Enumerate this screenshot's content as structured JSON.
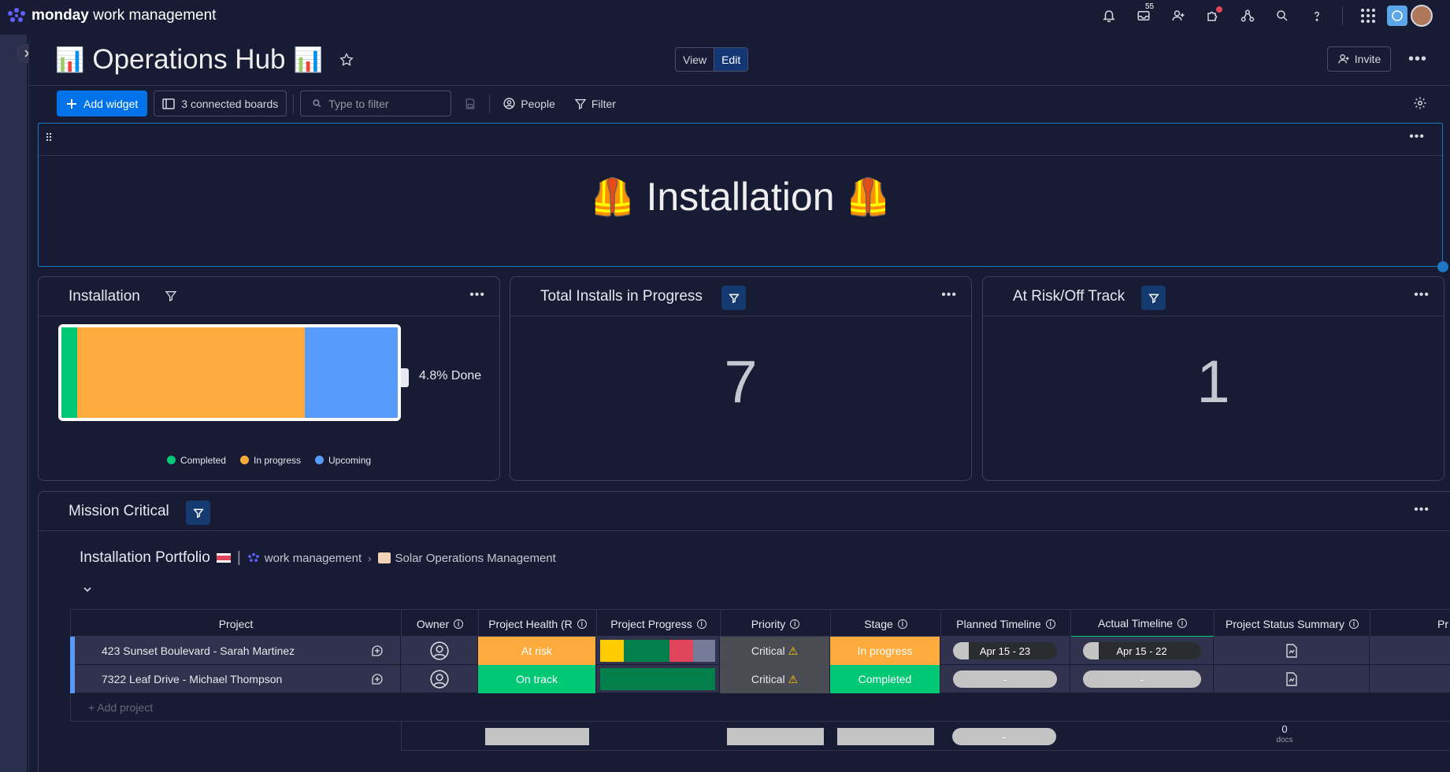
{
  "app": {
    "brand_bold": "monday",
    "brand_rest": "work management",
    "notifications_badge": "55"
  },
  "board": {
    "title": "Operations Hub",
    "view_label": "View",
    "edit_label": "Edit",
    "invite_label": "Invite"
  },
  "toolbar": {
    "add_widget": "Add widget",
    "connected_boards": "3 connected boards",
    "filter_placeholder": "Type to filter",
    "people": "People",
    "filter": "Filter"
  },
  "banner": {
    "title": "Installation"
  },
  "widgets": {
    "installation": {
      "title": "Installation",
      "done_label": "4.8% Done",
      "legend": [
        "Completed",
        "In progress",
        "Upcoming"
      ]
    },
    "total_installs": {
      "title": "Total Installs in Progress",
      "value": "7"
    },
    "at_risk": {
      "title": "At Risk/Off Track",
      "value": "1"
    }
  },
  "chart_data": {
    "type": "bar",
    "title": "Installation",
    "categories": [
      "Completed",
      "In progress",
      "Upcoming"
    ],
    "values": [
      4.8,
      67.5,
      27.7
    ],
    "colors": [
      "#00c875",
      "#fdab3d",
      "#579bfc"
    ],
    "annotation": "4.8% Done",
    "stacked": true,
    "legend": "bottom"
  },
  "mission": {
    "title": "Mission Critical",
    "portfolio": "Installation Portfolio",
    "crumb_product": "work management",
    "crumb_board": "Solar Operations Management",
    "columns": [
      "Project",
      "Owner",
      "Project Health (R",
      "Project Progress",
      "Priority",
      "Stage",
      "Planned Timeline",
      "Actual Timeline",
      "Project Status Summary",
      "Pr"
    ],
    "rows": [
      {
        "project": "423 Sunset Boulevard - Sarah Martinez",
        "health": "At risk",
        "priority": "Critical",
        "stage": "In progress",
        "planned": "Apr 15 - 23",
        "actual": "Apr 15 - 22"
      },
      {
        "project": "7322 Leaf Drive - Michael Thompson",
        "health": "On track",
        "priority": "Critical",
        "stage": "Completed",
        "planned": "-",
        "actual": "-"
      }
    ],
    "add_project": "+ Add project",
    "summary_timeline": "-",
    "docs_count": "0",
    "docs_label": "docs"
  },
  "colors": {
    "accent": "#0073ea",
    "at_risk": "#fdab3d",
    "on_track": "#00c875",
    "completed": "#00c875",
    "in_progress": "#fdab3d",
    "upcoming": "#579bfc"
  }
}
